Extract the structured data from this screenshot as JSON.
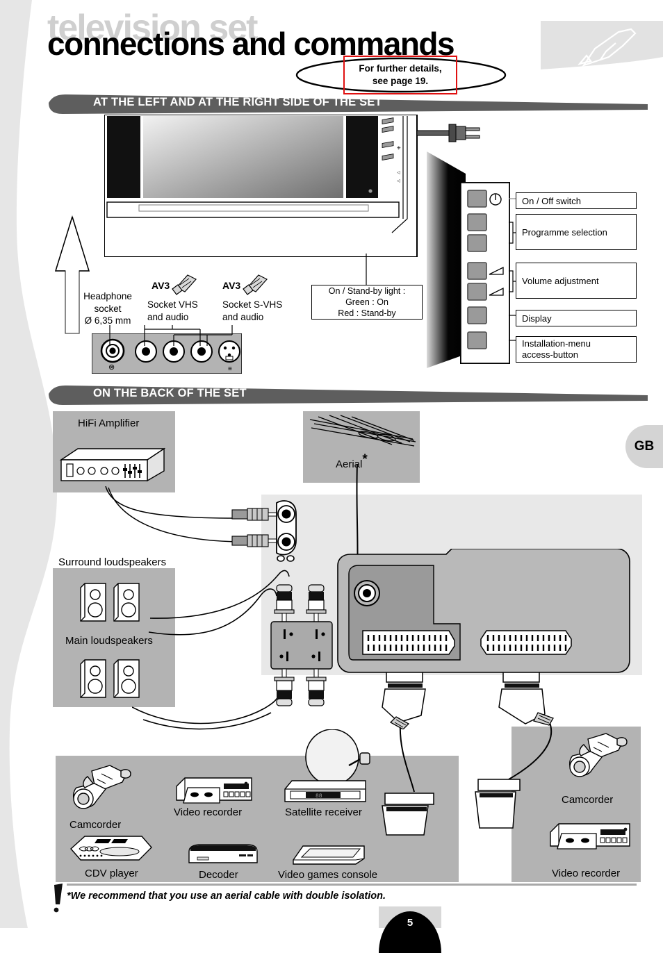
{
  "page": {
    "ghost_title": "television set",
    "title": "connections and commands",
    "page_number": "5",
    "language_tab": "GB"
  },
  "callout": {
    "line1": "For further details,",
    "line2": "see page 19.",
    "border_color": "#e01010"
  },
  "sections": [
    {
      "id": "left-right",
      "heading": "AT THE LEFT AND AT THE RIGHT SIDE OF THE SET"
    },
    {
      "id": "back",
      "heading": "ON THE BACK OF THE SET"
    }
  ],
  "front_panel": {
    "arrow_name": "up-arrow",
    "headphone": {
      "line1": "Headphone",
      "line2": "socket",
      "line3": "Ø 6,35 mm"
    },
    "av3_vhs": {
      "tag": "AV3",
      "line1": "Socket VHS",
      "line2": "and audio"
    },
    "av3_svhs": {
      "tag": "AV3",
      "line1": "Socket S-VHS",
      "line2": "and audio"
    },
    "standby_box": {
      "line1": "On / Stand-by light :",
      "line2": "Green : On",
      "line3": "Red : Stand-by"
    }
  },
  "side_controls": [
    {
      "label": "On / Off switch",
      "icon": "power-icon"
    },
    {
      "label": "Programme selection",
      "icon": ""
    },
    {
      "label": "Volume adjustment",
      "icon": "volume-wedge-icon"
    },
    {
      "label": "Display",
      "icon": ""
    },
    {
      "label": "Installation-menu\naccess-button",
      "line1": "Installation-menu",
      "line2": "access-button",
      "icon": ""
    }
  ],
  "back_panel": {
    "hifi_amplifier": "HiFi Amplifier",
    "aerial": "Aerial",
    "aerial_asterisk": "*",
    "surround_loudspeakers": "Surround loudspeakers",
    "main_loudspeakers": "Main loudspeakers"
  },
  "devices_left": [
    {
      "label": "Camcorder",
      "icon": "camcorder-icon"
    },
    {
      "label": "Video recorder",
      "icon": "video-recorder-icon"
    },
    {
      "label": "Satellite receiver",
      "icon": "satellite-receiver-icon"
    },
    {
      "label": "CDV player",
      "icon": "cdv-player-icon"
    },
    {
      "label": "Decoder",
      "icon": "decoder-icon"
    },
    {
      "label": "Video games console",
      "icon": "video-games-console-icon"
    }
  ],
  "devices_right": [
    {
      "label": "Camcorder",
      "icon": "camcorder-icon"
    },
    {
      "label": "Video recorder",
      "icon": "video-recorder-icon"
    }
  ],
  "footnote": {
    "marker": "*",
    "text": "We recommend that you use an aerial cable with double isolation."
  },
  "colors": {
    "ribbon": "#5e5e5e",
    "panel_grey": "#b3b3b3",
    "panel_light": "#e8e8e8",
    "ghost_title": "#cfcfcf",
    "accent_red": "#e01010"
  }
}
